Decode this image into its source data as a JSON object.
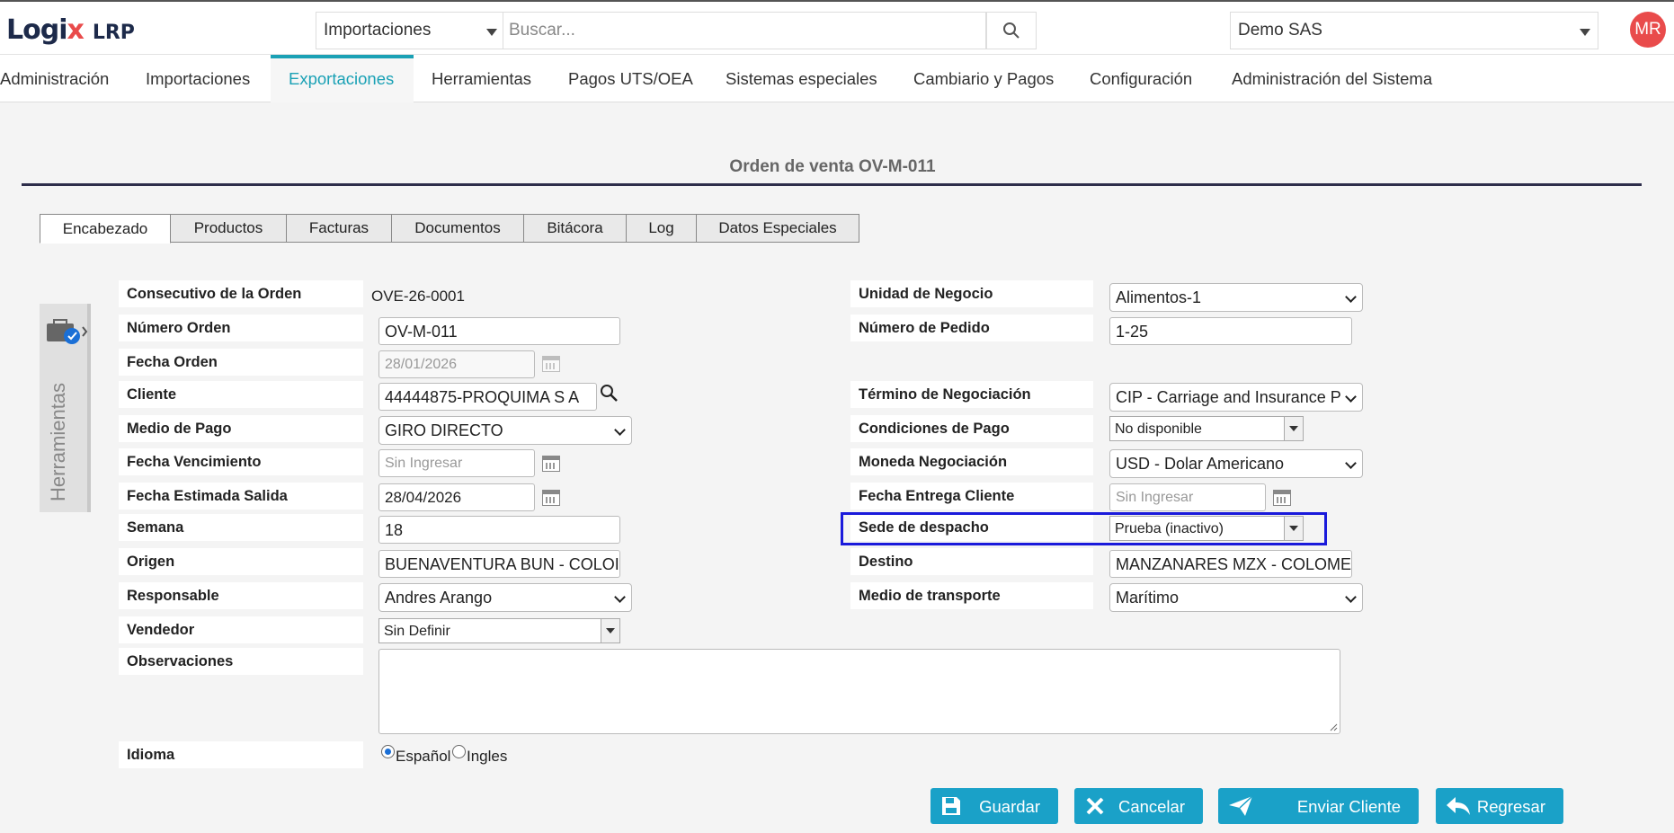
{
  "header": {
    "logo_text": "Logi",
    "logo_mark": "x",
    "logo_suffix": "LRP",
    "module_select": "Importaciones",
    "search_placeholder": "Buscar...",
    "company": "Demo SAS",
    "avatar_initials": "MR"
  },
  "nav": {
    "items": [
      "Administración",
      "Importaciones",
      "Exportaciones",
      "Herramientas",
      "Pagos UTS/OEA",
      "Sistemas especiales",
      "Cambiario y Pagos",
      "Configuración",
      "Administración del Sistema"
    ],
    "active": "Exportaciones"
  },
  "page": {
    "title": "Orden de venta OV-M-011"
  },
  "tabs": [
    "Encabezado",
    "Productos",
    "Facturas",
    "Documentos",
    "Bitácora",
    "Log",
    "Datos Especiales"
  ],
  "side_panel": {
    "label": "Herramientas"
  },
  "form_left": {
    "consecutivo": {
      "label": "Consecutivo de la Orden",
      "value": "OVE-26-0001"
    },
    "numero_orden": {
      "label": "Número Orden",
      "value": "OV-M-011"
    },
    "fecha_orden": {
      "label": "Fecha Orden",
      "value": "28/01/2026"
    },
    "cliente": {
      "label": "Cliente",
      "value": "44444875-PROQUIMA S A"
    },
    "medio_pago": {
      "label": "Medio de Pago",
      "value": "GIRO DIRECTO"
    },
    "fecha_vencimiento": {
      "label": "Fecha Vencimiento",
      "placeholder": "Sin Ingresar"
    },
    "fecha_estimada": {
      "label": "Fecha Estimada Salida",
      "value": "28/04/2026"
    },
    "semana": {
      "label": "Semana",
      "value": "18"
    },
    "origen": {
      "label": "Origen",
      "value": "BUENAVENTURA BUN - COLOI"
    },
    "responsable": {
      "label": "Responsable",
      "value": "Andres Arango"
    },
    "vendedor": {
      "label": "Vendedor",
      "value": "Sin Definir"
    },
    "observaciones": {
      "label": "Observaciones"
    },
    "idioma": {
      "label": "Idioma",
      "options": [
        "Español",
        "Ingles"
      ],
      "selected": "Español"
    }
  },
  "form_right": {
    "unidad_negocio": {
      "label": "Unidad de Negocio",
      "value": "Alimentos-1"
    },
    "numero_pedido": {
      "label": "Número de Pedido",
      "value": "1-25"
    },
    "termino": {
      "label": "Término de Negociación",
      "value": "CIP - Carriage and Insurance P"
    },
    "condiciones_pago": {
      "label": "Condiciones de Pago",
      "value": "No disponible"
    },
    "moneda": {
      "label": "Moneda Negociación",
      "value": "USD - Dolar Americano"
    },
    "fecha_entrega": {
      "label": "Fecha Entrega Cliente",
      "placeholder": "Sin Ingresar"
    },
    "sede": {
      "label": "Sede de despacho",
      "value": "Prueba (inactivo)"
    },
    "destino": {
      "label": "Destino",
      "value": "MANZANARES MZX - COLOME"
    },
    "medio_transporte": {
      "label": "Medio de transporte",
      "value": "Marítimo"
    }
  },
  "actions": {
    "save": "Guardar",
    "cancel": "Cancelar",
    "send": "Enviar Cliente",
    "back": "Regresar"
  },
  "colors": {
    "accent": "#1aa1b5",
    "button": "#1aa1c8",
    "highlight": "#1a1adb",
    "avatar": "#e94b4b"
  }
}
